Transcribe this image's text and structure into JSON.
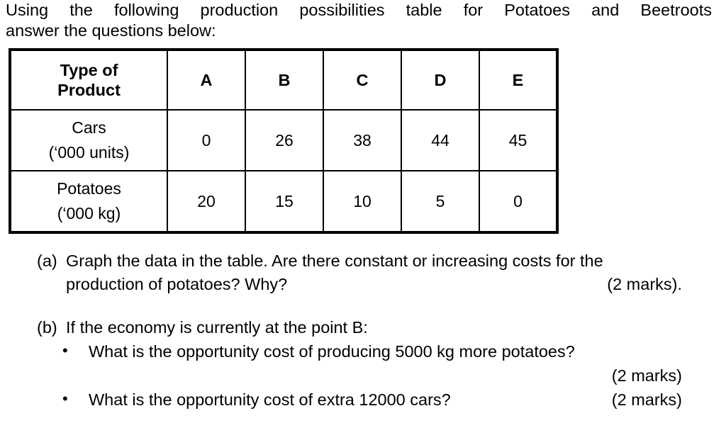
{
  "document": {
    "intro": {
      "line1": "Using the following production possibilities table for Potatoes and Beetroots",
      "line2": "answer the questions below:"
    },
    "table": {
      "header": [
        "Type of Product",
        "A",
        "B",
        "C",
        "D",
        "E"
      ],
      "header_label_line1": "Type of",
      "header_label_line2": "Product",
      "rows": [
        {
          "label_name": "Cars",
          "label_unit": "(‘000 units)",
          "values": [
            "0",
            "26",
            "38",
            "44",
            "45"
          ]
        },
        {
          "label_name": "Potatoes",
          "label_unit": "(‘000 kg)",
          "values": [
            "20",
            "15",
            "10",
            "5",
            "0"
          ]
        }
      ]
    },
    "questions": [
      {
        "marker": "(a)",
        "text_line1": "Graph the data in the table. Are there constant or increasing costs for the",
        "text_line2": "production of potatoes? Why?",
        "marks": "(2 marks)."
      },
      {
        "marker": "(b)",
        "text_line1": "If the economy is currently at the point B:",
        "bullets": [
          {
            "bullet": "•",
            "text": "What is the opportunity cost of producing 5000 kg more potatoes?",
            "marks": "(2 marks)"
          },
          {
            "bullet": "•",
            "text": "What is the opportunity cost of extra 12000 cars?",
            "marks": "(2 marks)"
          }
        ]
      }
    ]
  }
}
